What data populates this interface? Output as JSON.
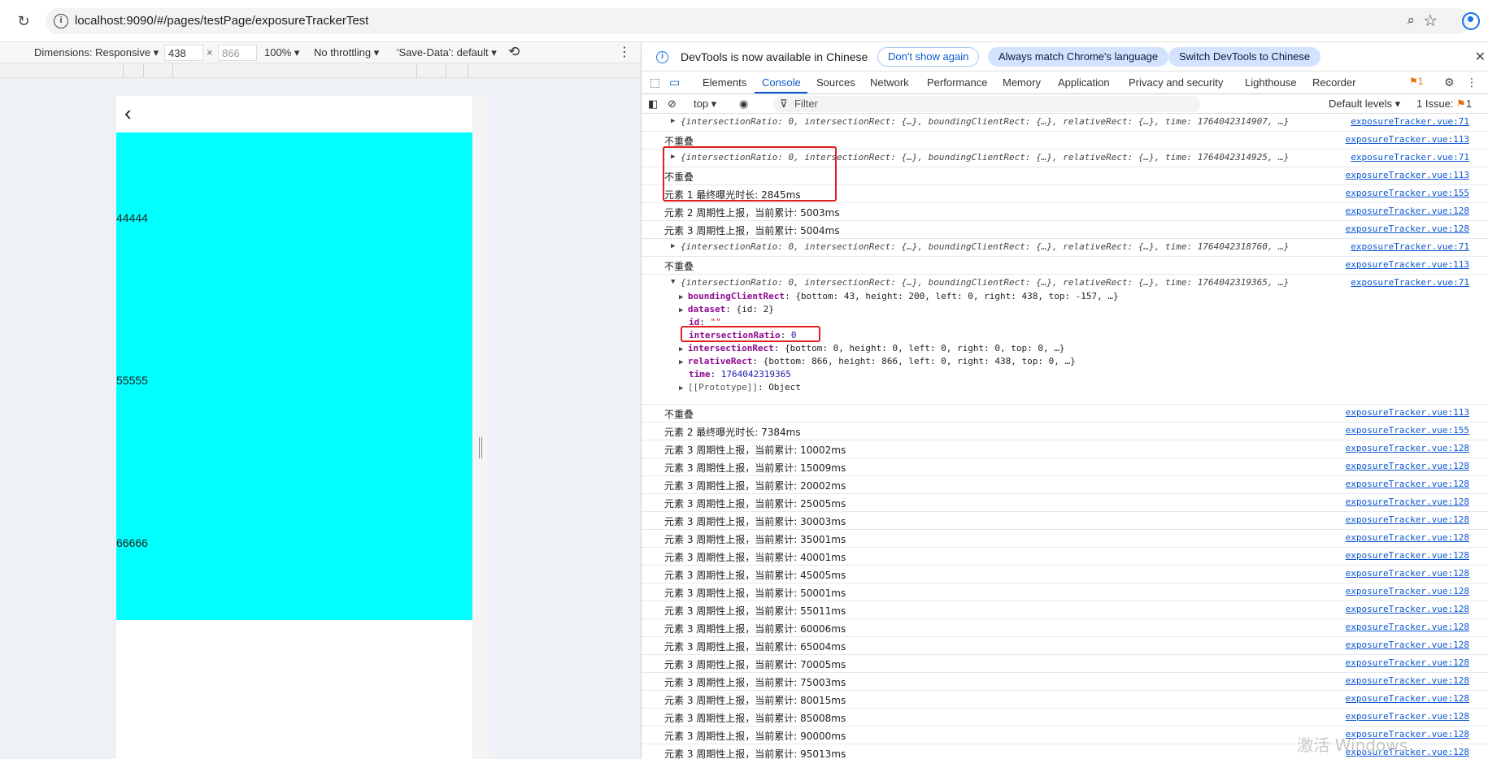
{
  "browser": {
    "url": "localhost:9090/#/pages/testPage/exposureTrackerTest"
  },
  "device_toolbar": {
    "dimensions_label": "Dimensions: Responsive ▾",
    "width": "438",
    "times": "×",
    "height": "866",
    "zoom": "100% ▾",
    "throttling": "No throttling ▾",
    "save_data": "'Save-Data': default ▾"
  },
  "page": {
    "back_icon": "‹",
    "labels": [
      "44444",
      "55555",
      "66666"
    ],
    "block_color": "#00ffff"
  },
  "devtools": {
    "banner_text": "DevTools is now available in Chinese",
    "dont_show_again": "Don't show again",
    "always_match": "Always match Chrome's language",
    "switch_chinese": "Switch DevTools to Chinese",
    "tabs": [
      "Elements",
      "Console",
      "Sources",
      "Network",
      "Performance",
      "Memory",
      "Application",
      "Privacy and security",
      "Lighthouse",
      "Recorder"
    ],
    "active_tab": "Console",
    "issue_count_badge": "1",
    "context": "top ▾",
    "filter_placeholder": "Filter",
    "default_levels": "Default levels ▾",
    "issues": "1 Issue:",
    "issues_count": "1"
  },
  "console": {
    "obj_rows": [
      {
        "text": "{intersectionRatio: 0, intersectionRect: {…}, boundingClientRect: {…}, relativeRect: {…}, time: 1764042314907, …}",
        "src": "exposureTracker.vue:71"
      },
      {
        "text": "{intersectionRatio: 0, intersectionRect: {…}, boundingClientRect: {…}, relativeRect: {…}, time: 1764042314925, …}",
        "src": "exposureTracker.vue:71"
      },
      {
        "text": "{intersectionRatio: 0, intersectionRect: {…}, boundingClientRect: {…}, relativeRect: {…}, time: 1764042318760, …}",
        "src": "exposureTracker.vue:71"
      },
      {
        "text": "{intersectionRatio: 0, intersectionRect: {…}, boundingClientRect: {…}, relativeRect: {…}, time: 1764042319365, …}",
        "src": "exposureTracker.vue:71"
      }
    ],
    "top_logs": [
      {
        "text": "不重叠",
        "src": "exposureTracker.vue:113"
      },
      {
        "text": "不重叠",
        "src": "exposureTracker.vue:113"
      },
      {
        "text": "元素 1 最终曝光时长: 2845ms",
        "src": "exposureTracker.vue:155"
      },
      {
        "text": "元素 2 周期性上报，当前累计: 5003ms",
        "src": "exposureTracker.vue:128"
      },
      {
        "text": "元素 3 周期性上报，当前累计: 5004ms",
        "src": "exposureTracker.vue:128"
      },
      {
        "text": "不重叠",
        "src": "exposureTracker.vue:113"
      }
    ],
    "expanded": {
      "bounding_key": "boundingClientRect",
      "bounding_val": "{bottom: 43, height: 200, left: 0, right: 438, top: -157, …}",
      "dataset_key": "dataset",
      "dataset_val": "{id: 2}",
      "id_key": "id",
      "id_val": "\"\"",
      "ratio_key": "intersectionRatio",
      "ratio_val": "0",
      "irect_key": "intersectionRect",
      "irect_val": "{bottom: 0, height: 0, left: 0, right: 0, top: 0, …}",
      "rrect_key": "relativeRect",
      "rrect_val": "{bottom: 866, height: 866, left: 0, right: 438, top: 0, …}",
      "time_key": "time",
      "time_val": "1764042319365",
      "proto_key": "[[Prototype]]",
      "proto_val": "Object"
    },
    "after_logs": [
      {
        "text": "不重叠",
        "src": "exposureTracker.vue:113"
      },
      {
        "text": "元素 2 最终曝光时长: 7384ms",
        "src": "exposureTracker.vue:155"
      },
      {
        "text": "元素 3 周期性上报，当前累计: 10002ms",
        "src": "exposureTracker.vue:128"
      },
      {
        "text": "元素 3 周期性上报，当前累计: 15009ms",
        "src": "exposureTracker.vue:128"
      },
      {
        "text": "元素 3 周期性上报，当前累计: 20002ms",
        "src": "exposureTracker.vue:128"
      },
      {
        "text": "元素 3 周期性上报，当前累计: 25005ms",
        "src": "exposureTracker.vue:128"
      },
      {
        "text": "元素 3 周期性上报，当前累计: 30003ms",
        "src": "exposureTracker.vue:128"
      },
      {
        "text": "元素 3 周期性上报，当前累计: 35001ms",
        "src": "exposureTracker.vue:128"
      },
      {
        "text": "元素 3 周期性上报，当前累计: 40001ms",
        "src": "exposureTracker.vue:128"
      },
      {
        "text": "元素 3 周期性上报，当前累计: 45005ms",
        "src": "exposureTracker.vue:128"
      },
      {
        "text": "元素 3 周期性上报，当前累计: 50001ms",
        "src": "exposureTracker.vue:128"
      },
      {
        "text": "元素 3 周期性上报，当前累计: 55011ms",
        "src": "exposureTracker.vue:128"
      },
      {
        "text": "元素 3 周期性上报，当前累计: 60006ms",
        "src": "exposureTracker.vue:128"
      },
      {
        "text": "元素 3 周期性上报，当前累计: 65004ms",
        "src": "exposureTracker.vue:128"
      },
      {
        "text": "元素 3 周期性上报，当前累计: 70005ms",
        "src": "exposureTracker.vue:128"
      },
      {
        "text": "元素 3 周期性上报，当前累计: 75003ms",
        "src": "exposureTracker.vue:128"
      },
      {
        "text": "元素 3 周期性上报，当前累计: 80015ms",
        "src": "exposureTracker.vue:128"
      },
      {
        "text": "元素 3 周期性上报，当前累计: 85008ms",
        "src": "exposureTracker.vue:128"
      },
      {
        "text": "元素 3 周期性上报，当前累计: 90000ms",
        "src": "exposureTracker.vue:128"
      },
      {
        "text": "元素 3 周期性上报，当前累计: 95013ms",
        "src": "exposureTracker.vue:128"
      }
    ],
    "highlight_color": "#e31f1f"
  },
  "watermark": "激活 Windows"
}
